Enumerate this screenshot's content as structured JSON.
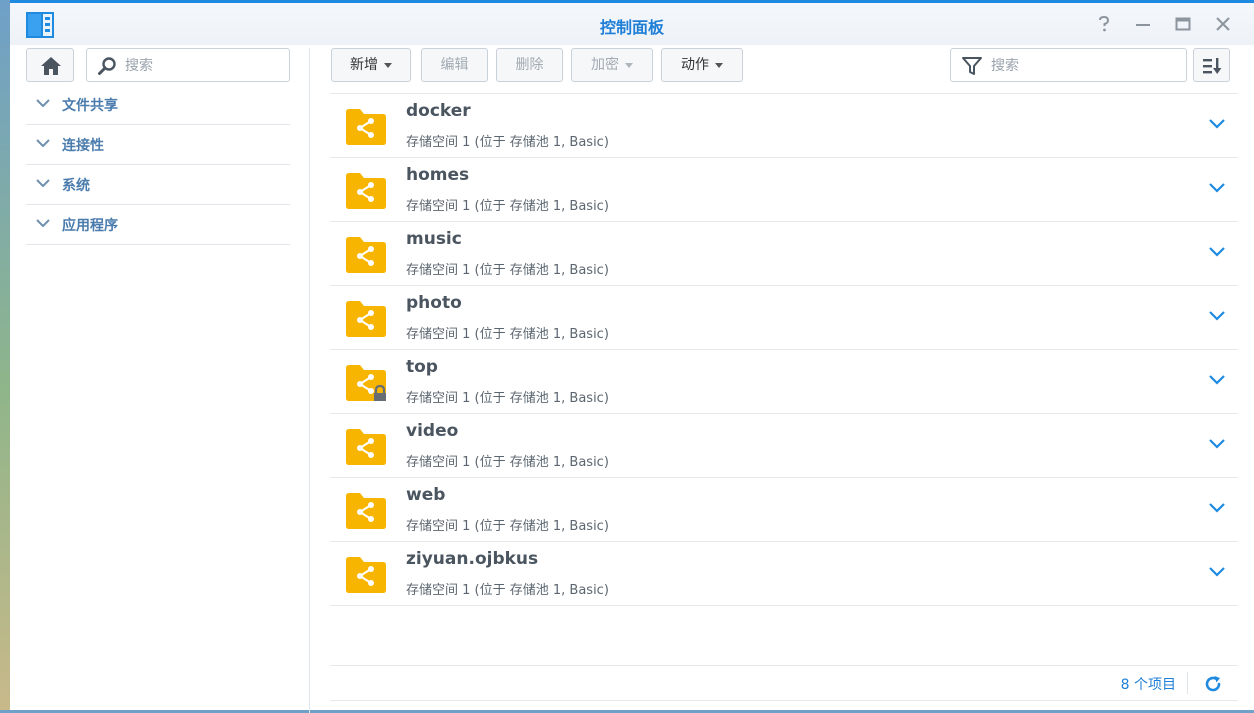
{
  "window": {
    "title": "控制面板"
  },
  "sidebar": {
    "search_placeholder": "搜索",
    "items": [
      {
        "label": "文件共享"
      },
      {
        "label": "连接性"
      },
      {
        "label": "系统"
      },
      {
        "label": "应用程序"
      }
    ]
  },
  "toolbar": {
    "create": "新增",
    "edit": "编辑",
    "delete": "删除",
    "encrypt": "加密",
    "action": "动作",
    "search_placeholder": "搜索"
  },
  "folders": [
    {
      "name": "docker",
      "location": "存储空间 1 (位于 存储池 1, Basic)",
      "locked": false
    },
    {
      "name": "homes",
      "location": "存储空间 1 (位于 存储池 1, Basic)",
      "locked": false
    },
    {
      "name": "music",
      "location": "存储空间 1 (位于 存储池 1, Basic)",
      "locked": false
    },
    {
      "name": "photo",
      "location": "存储空间 1 (位于 存储池 1, Basic)",
      "locked": false
    },
    {
      "name": "top",
      "location": "存储空间 1 (位于 存储池 1, Basic)",
      "locked": true
    },
    {
      "name": "video",
      "location": "存储空间 1 (位于 存储池 1, Basic)",
      "locked": false
    },
    {
      "name": "web",
      "location": "存储空间 1 (位于 存储池 1, Basic)",
      "locked": false
    },
    {
      "name": "ziyuan.ojbkus",
      "location": "存储空间 1 (位于 存储池 1, Basic)",
      "locked": false
    }
  ],
  "footer": {
    "count": "8 个项目"
  },
  "colors": {
    "accent": "#1f7fd6",
    "folder": "#f7b500",
    "nav_text": "#4a7cad"
  }
}
